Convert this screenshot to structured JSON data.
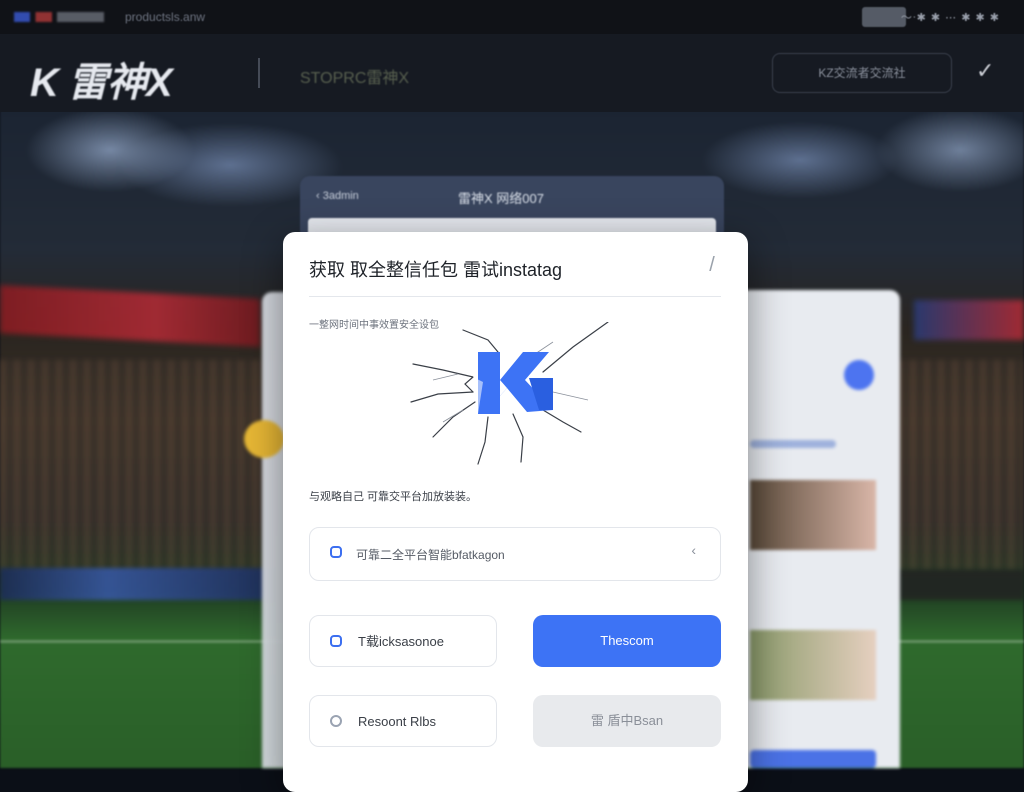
{
  "topbar": {
    "url": "productsls.anw",
    "right_text": "〜ᐧ✱ ✱ ⋯ ✱ ✱ ✱"
  },
  "header": {
    "logo": "K 雷神X",
    "tagline": "STOPRC雷神X",
    "button_label": "KZ交流者交流社",
    "chevron": "✓"
  },
  "back_card": {
    "left_label": "‹ 3admin",
    "title": "雷神X 网络007"
  },
  "modal": {
    "title": "获取 取全整信任包 雷试instatag",
    "close_icon": "/",
    "subtitle": "一整网时间中事效置安全设包",
    "description": "与观略自己 可靠交平台加放装装。",
    "option": {
      "label": "可靠二全平台智能bfatkagon",
      "chevron": "‹"
    },
    "buttons": {
      "download_label": "T载icksasonoe",
      "primary_label": "Thescom",
      "secondary_label": "Resoont Rlbs",
      "disabled_label": "雷 盾中Bsan"
    }
  },
  "colors": {
    "accent": "#3d73f5",
    "modal_bg": "#ffffff",
    "header_bg": "#161a22"
  }
}
